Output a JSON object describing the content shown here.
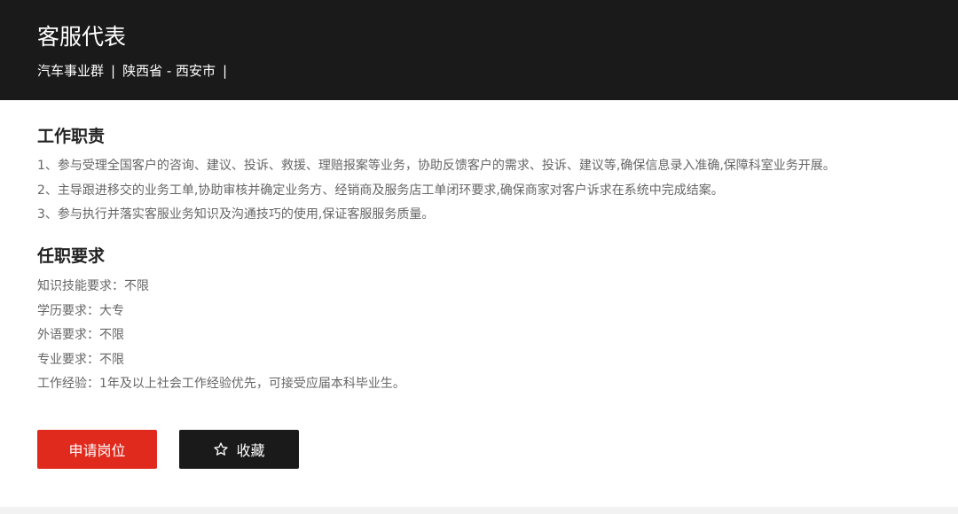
{
  "header": {
    "title": "客服代表",
    "department": "汽车事业群",
    "separator": "|",
    "location": "陕西省 - 西安市"
  },
  "responsibilities": {
    "title": "工作职责",
    "items": [
      "1、参与受理全国客户的咨询、建议、投诉、救援、理赔报案等业务，协助反馈客户的需求、投诉、建议等,确保信息录入准确,保障科室业务开展。",
      "2、主导跟进移交的业务工单,协助审核并确定业务方、经销商及服务店工单闭环要求,确保商家对客户诉求在系统中完成结案。",
      "3、参与执行并落实客服业务知识及沟通技巧的使用,保证客服服务质量。"
    ]
  },
  "requirements": {
    "title": "任职要求",
    "items": [
      "知识技能要求：不限",
      "学历要求：大专",
      "外语要求：不限",
      "专业要求：不限",
      "工作经验：1年及以上社会工作经验优先，可接受应届本科毕业生。"
    ]
  },
  "actions": {
    "apply_label": "申请岗位",
    "favorite_label": "收藏",
    "favorite_icon": "star-outline-icon"
  },
  "colors": {
    "header_bg": "#1a1a1a",
    "apply_bg": "#e02a1e",
    "favorite_bg": "#1a1a1a",
    "body_text": "#666666",
    "heading_text": "#222222"
  }
}
